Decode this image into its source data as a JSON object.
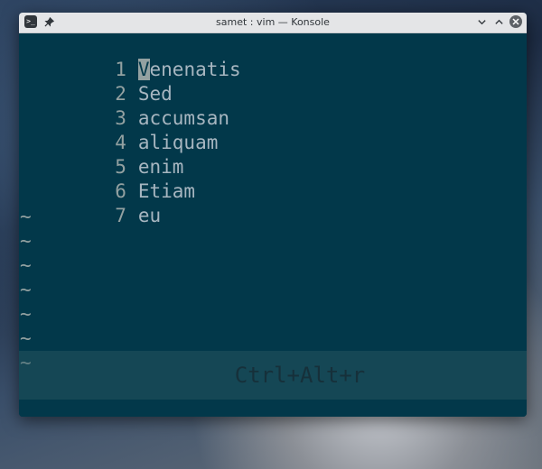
{
  "window": {
    "title": "samet : vim — Konsole"
  },
  "editor": {
    "lines": [
      {
        "num": "1",
        "cursor_char": "V",
        "rest": "enenatis"
      },
      {
        "num": "2",
        "text": "Sed"
      },
      {
        "num": "3",
        "text": "accumsan"
      },
      {
        "num": "4",
        "text": "aliquam"
      },
      {
        "num": "5",
        "text": "enim"
      },
      {
        "num": "6",
        "text": "Etiam"
      },
      {
        "num": "7",
        "text": "eu"
      }
    ],
    "empty_marker": "~"
  },
  "overlay": {
    "shortcut": "Ctrl+Alt+r"
  },
  "icons": {
    "app": "terminal-icon",
    "pin": "pin-icon",
    "minimize": "chevron-down-icon",
    "maximize": "chevron-up-icon",
    "close": "close-icon"
  },
  "colors": {
    "terminal_bg": "#02384a",
    "text": "#a7b6c0",
    "line_number": "#93a1a1",
    "titlebar": "#e4e5e7"
  }
}
